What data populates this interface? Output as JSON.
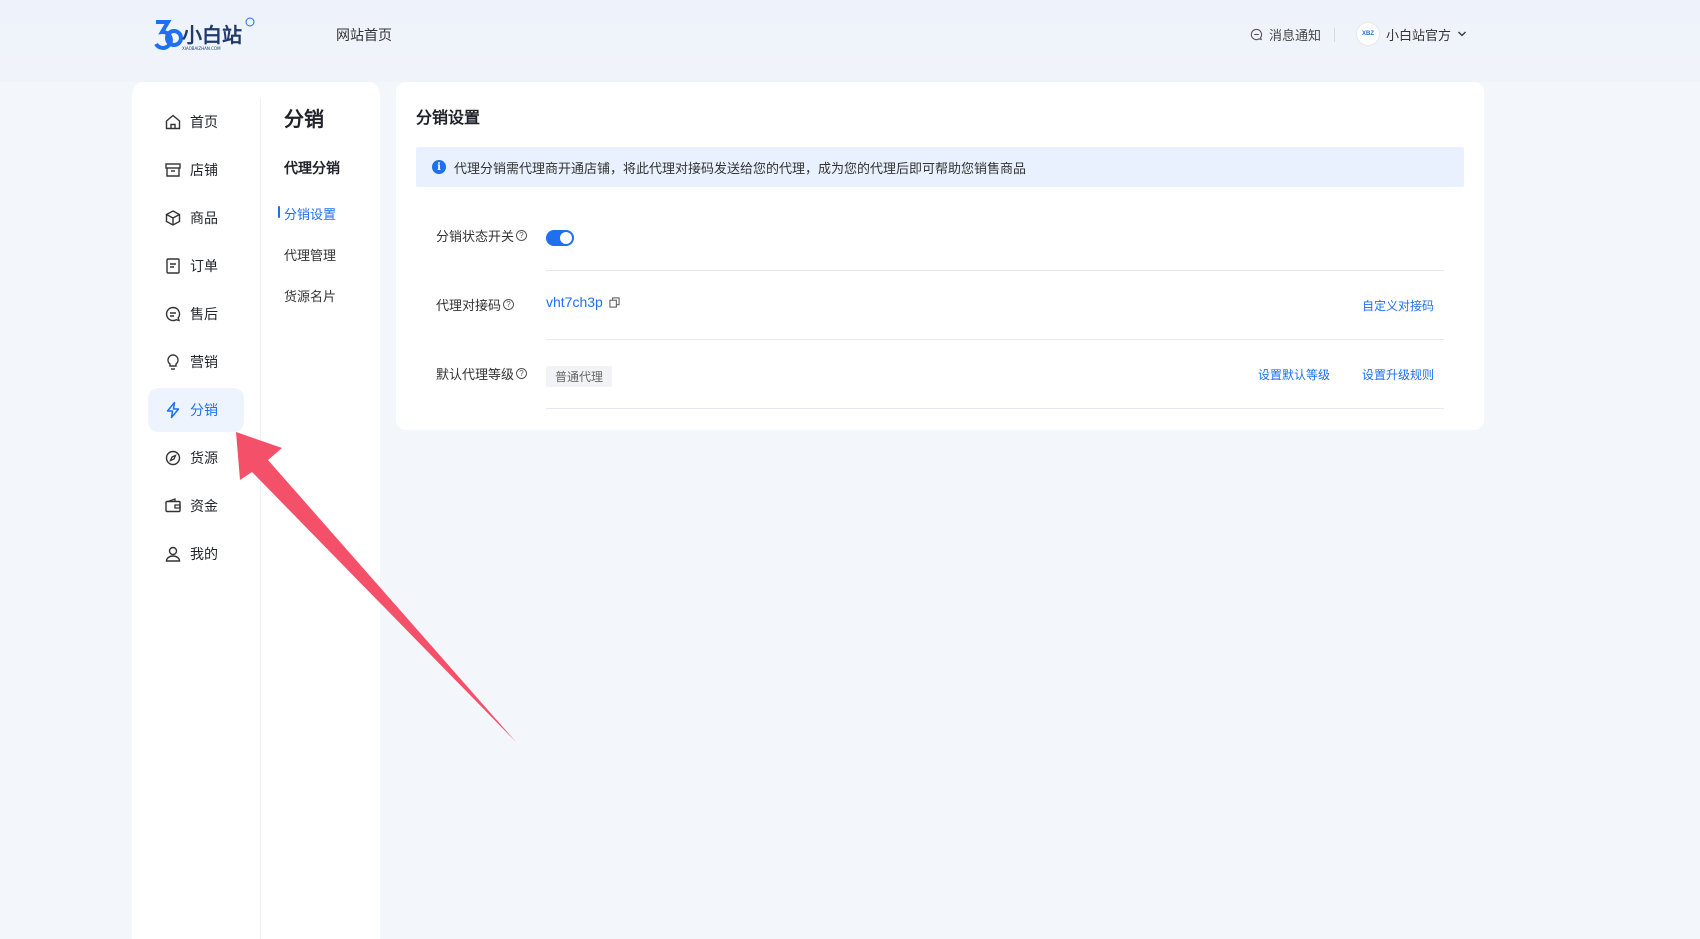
{
  "header": {
    "logo_text": "小白站",
    "logo_sub": "XIAOBAIZHAN.COM",
    "site_home": "网站首页",
    "notice": "消息通知",
    "user_name": "小白站官方",
    "avatar_text": "XBZ"
  },
  "sidebar": {
    "items": [
      {
        "label": "首页",
        "icon": "home-icon"
      },
      {
        "label": "店铺",
        "icon": "store-icon"
      },
      {
        "label": "商品",
        "icon": "box-icon"
      },
      {
        "label": "订单",
        "icon": "order-icon"
      },
      {
        "label": "售后",
        "icon": "chat-icon"
      },
      {
        "label": "营销",
        "icon": "bulb-icon"
      },
      {
        "label": "分销",
        "icon": "bolt-icon",
        "active": true
      },
      {
        "label": "货源",
        "icon": "compass-icon"
      },
      {
        "label": "资金",
        "icon": "wallet-icon"
      },
      {
        "label": "我的",
        "icon": "user-icon"
      }
    ]
  },
  "subnav": {
    "title": "分销",
    "group": "代理分销",
    "items": [
      "分销设置",
      "代理管理",
      "货源名片"
    ]
  },
  "main": {
    "title": "分销设置",
    "info": "代理分销需代理商开通店铺，将此代理对接码发送给您的代理，成为您的代理后即可帮助您销售商品",
    "rows": {
      "status_label": "分销状态开关",
      "code_label": "代理对接码",
      "code_value": "vht7ch3p",
      "custom_code_link": "自定义对接码",
      "level_label": "默认代理等级",
      "level_value": "普通代理",
      "set_default_link": "设置默认等级",
      "set_upgrade_link": "设置升级规则"
    }
  },
  "colors": {
    "accent": "#1f6ff0",
    "arrow": "#f5506a"
  }
}
